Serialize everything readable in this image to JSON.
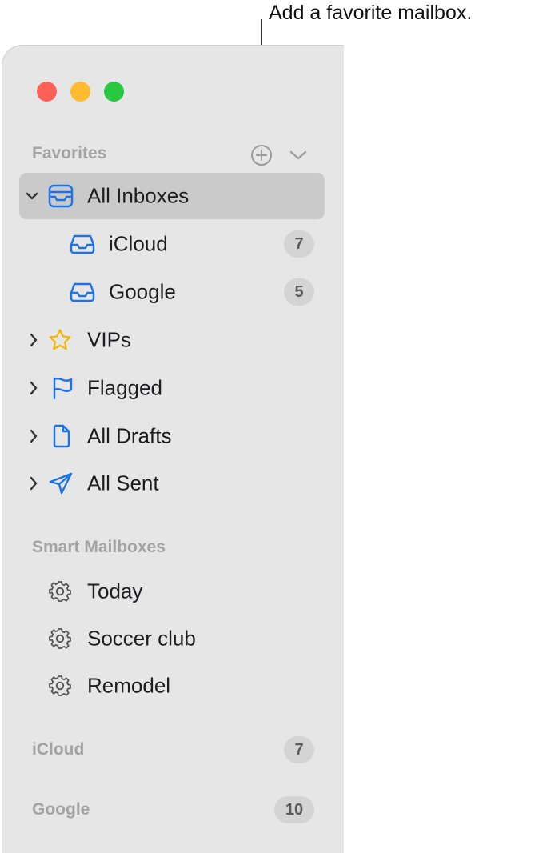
{
  "callout": {
    "text": "Add a favorite mailbox."
  },
  "favorites": {
    "header": "Favorites",
    "items": [
      {
        "label": "All Inboxes",
        "selected": true,
        "expanded": true,
        "icon": "tray-stack-icon"
      },
      {
        "label": "iCloud",
        "badge": "7",
        "icon": "tray-icon"
      },
      {
        "label": "Google",
        "badge": "5",
        "icon": "tray-icon"
      },
      {
        "label": "VIPs",
        "icon": "star-icon"
      },
      {
        "label": "Flagged",
        "icon": "flag-icon"
      },
      {
        "label": "All Drafts",
        "icon": "document-icon"
      },
      {
        "label": "All Sent",
        "icon": "paperplane-icon"
      }
    ]
  },
  "smart_mailboxes": {
    "header": "Smart Mailboxes",
    "items": [
      {
        "label": "Today",
        "icon": "gear-icon"
      },
      {
        "label": "Soccer club",
        "icon": "gear-icon"
      },
      {
        "label": "Remodel",
        "icon": "gear-icon"
      }
    ]
  },
  "accounts": [
    {
      "label": "iCloud",
      "badge": "7"
    },
    {
      "label": "Google",
      "badge": "10"
    }
  ],
  "colors": {
    "accent": "#1a73e8",
    "star": "#f2b705",
    "selected_row": "#cacaca"
  }
}
